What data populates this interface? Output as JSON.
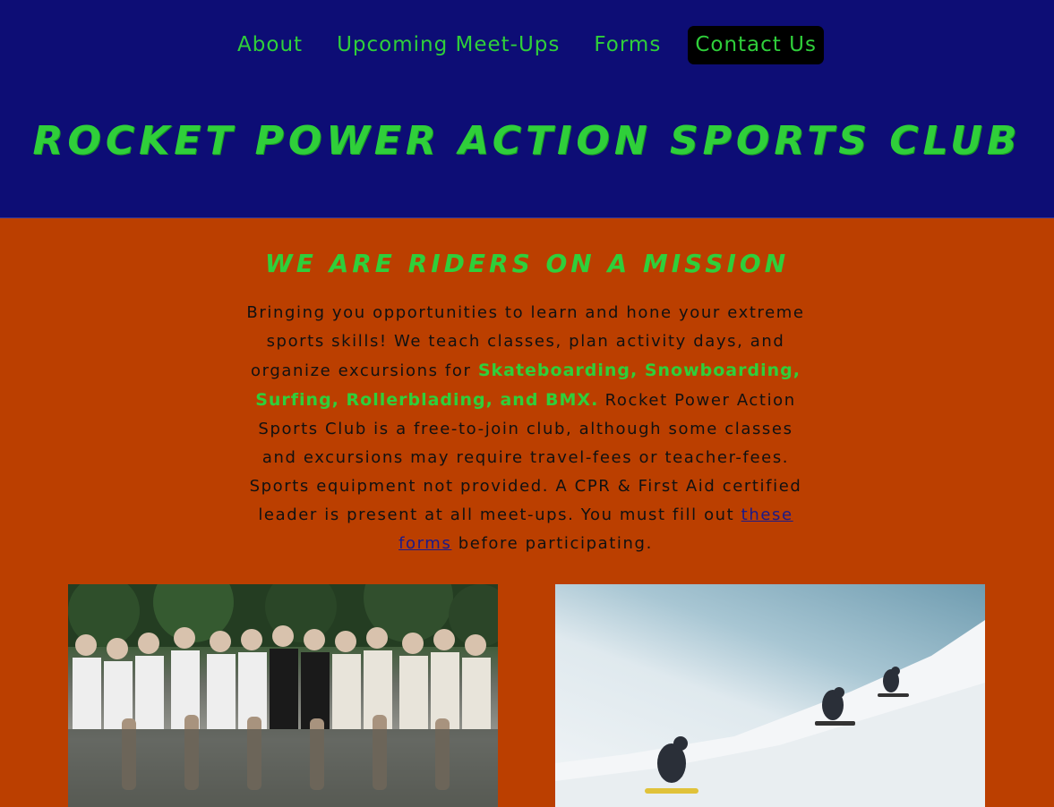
{
  "nav": {
    "items": [
      {
        "label": "About"
      },
      {
        "label": "Upcoming Meet-Ups"
      },
      {
        "label": "Forms"
      },
      {
        "label": "Contact Us"
      }
    ]
  },
  "header": {
    "title": "Rocket Power Action Sports Club"
  },
  "mission": {
    "heading": "We are Riders on a Mission",
    "text_intro": "Bringing you opportunities to learn and hone your extreme sports skills! We teach classes, plan activity days, and organize excursions for ",
    "sports": "Skateboarding, Snowboarding, Surfing, Rollerblading, and BMX.",
    "text_middle": " Rocket Power Action Sports Club is a free-to-join club, although some classes and excursions may require travel-fees or teacher-fees. Sports equipment not provided. A CPR & First Aid certified leader is present at all meet-ups. You must fill out ",
    "link_label": "these forms",
    "text_end": " before participating."
  },
  "colors": {
    "header_bg": "#0d0d75",
    "page_bg": "#bb3f00",
    "accent_green": "#2fcf3a"
  }
}
